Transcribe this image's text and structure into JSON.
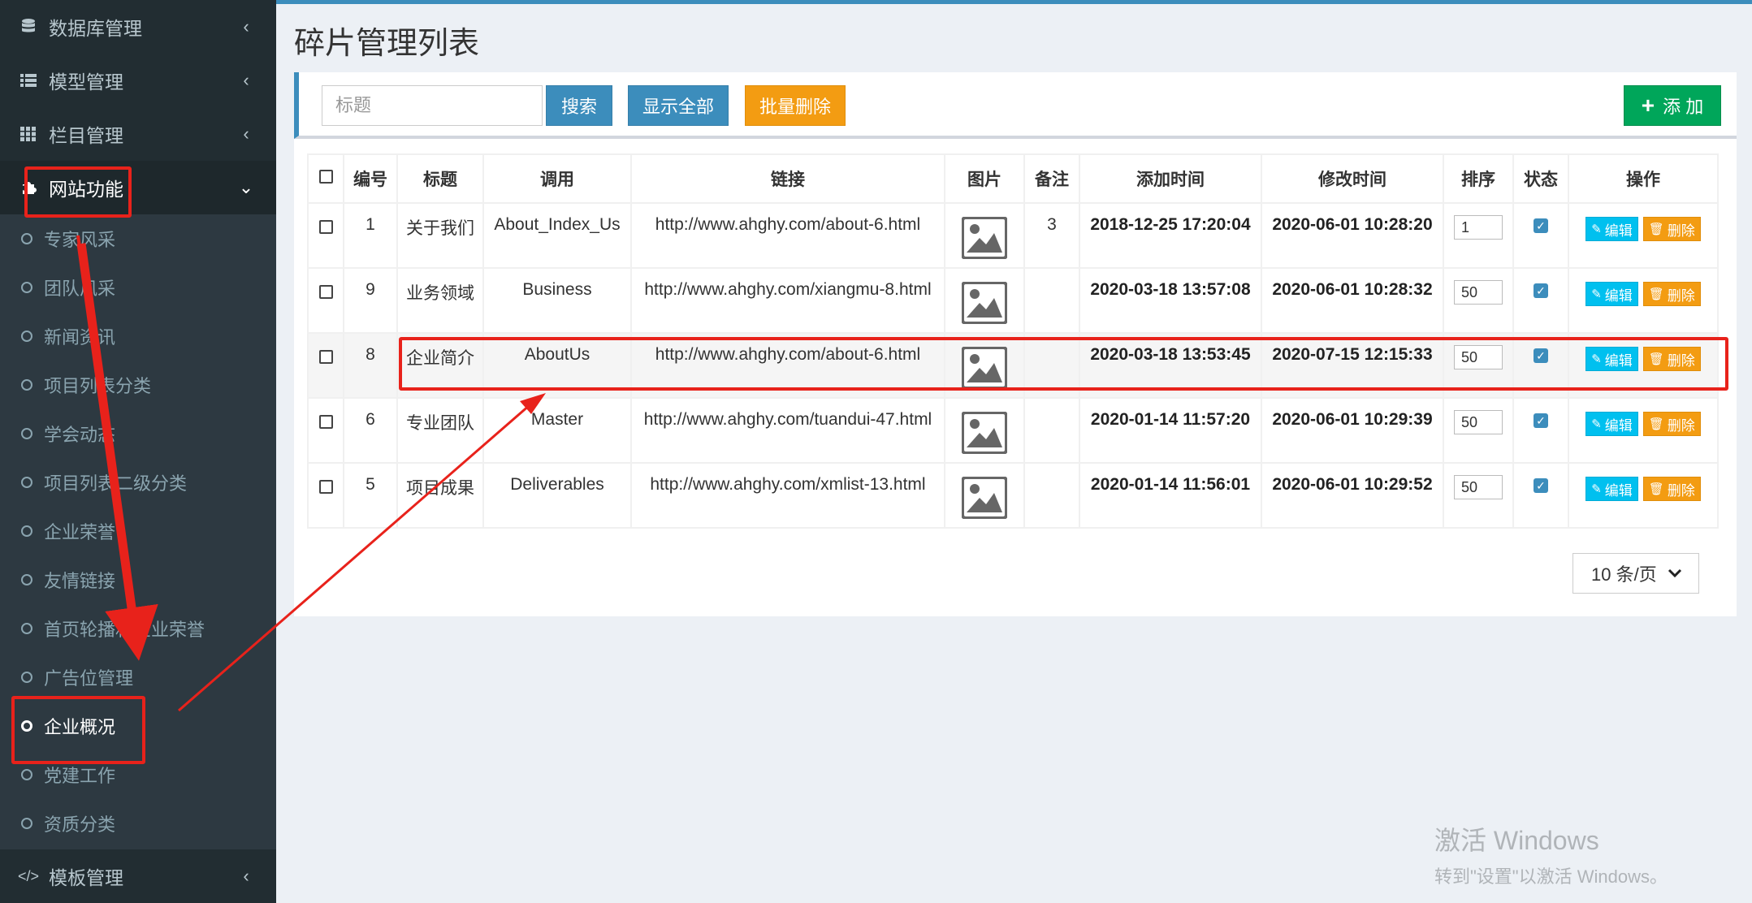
{
  "sidebar": {
    "items": [
      {
        "label": "数据库管理",
        "icon": "database-icon",
        "expanded": false
      },
      {
        "label": "模型管理",
        "icon": "list-icon",
        "expanded": false
      },
      {
        "label": "栏目管理",
        "icon": "grid-icon",
        "expanded": false
      },
      {
        "label": "网站功能",
        "icon": "puzzle-icon",
        "expanded": true
      },
      {
        "label": "模板管理",
        "icon": "code-icon",
        "expanded": false
      }
    ],
    "submenu": [
      "专家风采",
      "团队风采",
      "新闻资讯",
      "项目列表分类",
      "学会动态",
      "项目列表二级分类",
      "企业荣誉",
      "友情链接",
      "首页轮播和企业荣誉",
      "广告位管理",
      "企业概况",
      "党建工作",
      "资质分类"
    ],
    "current_submenu": "企业概况"
  },
  "page": {
    "title": "碎片管理列表"
  },
  "toolbar": {
    "search_placeholder": "标题",
    "search_label": "搜索",
    "show_all_label": "显示全部",
    "batch_delete_label": "批量删除",
    "add_label": "添 加"
  },
  "table": {
    "columns": [
      "编号",
      "标题",
      "调用",
      "链接",
      "图片",
      "备注",
      "添加时间",
      "修改时间",
      "排序",
      "状态",
      "操作"
    ],
    "rows": [
      {
        "id": "1",
        "title": "关于我们",
        "call": "About_Index_Us",
        "link": "http://www.ahghy.com/about-6.html",
        "note": "3",
        "added": "2018-12-25 17:20:04",
        "modified": "2020-06-01 10:28:20",
        "sort": "1",
        "status": true
      },
      {
        "id": "9",
        "title": "业务领域",
        "call": "Business",
        "link": "http://www.ahghy.com/xiangmu-8.html",
        "note": "",
        "added": "2020-03-18 13:57:08",
        "modified": "2020-06-01 10:28:32",
        "sort": "50",
        "status": true
      },
      {
        "id": "8",
        "title": "企业简介",
        "call": "AboutUs",
        "link": "http://www.ahghy.com/about-6.html",
        "note": "",
        "added": "2020-03-18 13:53:45",
        "modified": "2020-07-15 12:15:33",
        "sort": "50",
        "status": true,
        "highlighted": true
      },
      {
        "id": "6",
        "title": "专业团队",
        "call": "Master",
        "link": "http://www.ahghy.com/tuandui-47.html",
        "note": "",
        "added": "2020-01-14 11:57:20",
        "modified": "2020-06-01 10:29:39",
        "sort": "50",
        "status": true
      },
      {
        "id": "5",
        "title": "项目成果",
        "call": "Deliverables",
        "link": "http://www.ahghy.com/xmlist-13.html",
        "note": "",
        "added": "2020-01-14 11:56:01",
        "modified": "2020-06-01 10:29:52",
        "sort": "50",
        "status": true
      }
    ],
    "edit_label": "编辑",
    "delete_label": "删除"
  },
  "pagination": {
    "page_size_label": "10 条/页"
  },
  "watermark": {
    "line1": "激活 Windows",
    "line2": "转到\"设置\"以激活 Windows。"
  },
  "colors": {
    "annotation": "#e8221b",
    "primary": "#3c8dbc",
    "warning": "#f39c12",
    "success": "#00a65a",
    "info": "#00c0ef"
  }
}
